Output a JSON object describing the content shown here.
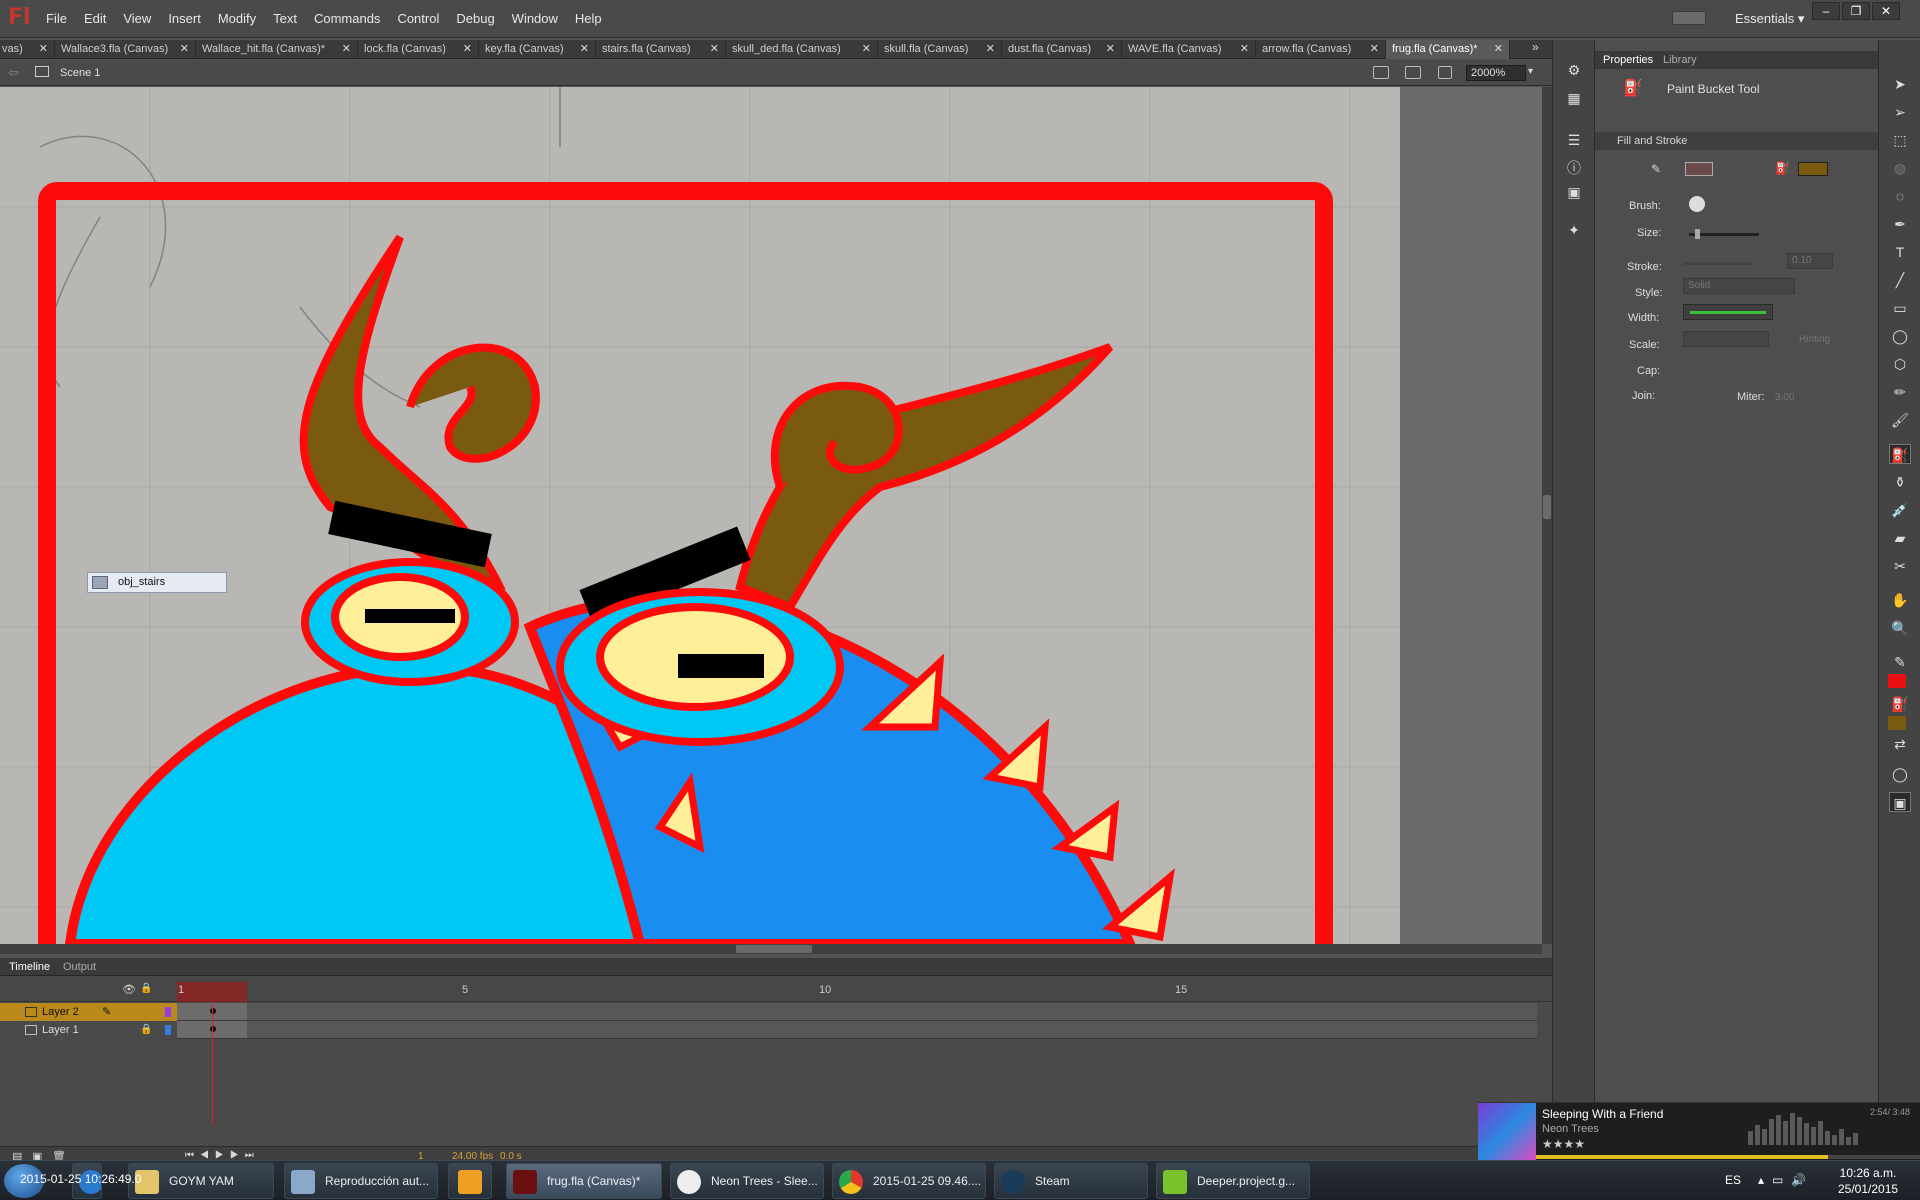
{
  "app": {
    "logo": "Fl"
  },
  "menu": {
    "items": [
      "File",
      "Edit",
      "View",
      "Insert",
      "Modify",
      "Text",
      "Commands",
      "Control",
      "Debug",
      "Window",
      "Help"
    ]
  },
  "workspace": {
    "label": "Essentials ▾"
  },
  "window_controls": {
    "minimize": "–",
    "restore": "❐",
    "close": "✕"
  },
  "tabs": [
    {
      "label": "vas)"
    },
    {
      "label": "Wallace3.fla (Canvas)"
    },
    {
      "label": "Wallace_hit.fla (Canvas)*"
    },
    {
      "label": "lock.fla (Canvas)"
    },
    {
      "label": "key.fla (Canvas)"
    },
    {
      "label": "stairs.fla (Canvas)"
    },
    {
      "label": "skull_ded.fla (Canvas)"
    },
    {
      "label": "skull.fla (Canvas)"
    },
    {
      "label": "dust.fla (Canvas)"
    },
    {
      "label": "WAVE.fla (Canvas)"
    },
    {
      "label": "arrow.fla (Canvas)"
    },
    {
      "label": "frug.fla (Canvas)*",
      "active": true
    }
  ],
  "tab_close": "✕",
  "tabs_more": "»",
  "scene": {
    "back": "⇦",
    "label": "Scene 1",
    "zoom": "2000%",
    "zoom_caret": "▾"
  },
  "tooltip": {
    "label": "obj_stairs"
  },
  "timeline": {
    "tabs": [
      "Timeline",
      "Output"
    ],
    "frame_numbers": [
      "1",
      "5",
      "10",
      "15"
    ],
    "layers": [
      {
        "name": "Layer 2",
        "active": true
      },
      {
        "name": "Layer 1",
        "active": false
      }
    ],
    "footer": {
      "current_frame": "1",
      "fps": "24.00 fps",
      "seconds": "0.0 s"
    }
  },
  "properties": {
    "tabs": [
      "Properties",
      "Library"
    ],
    "tool_name": "Paint Bucket Tool",
    "section": "Fill and Stroke",
    "labels": {
      "brush": "Brush:",
      "size": "Size:",
      "stroke": "Stroke:",
      "style": "Style:",
      "width": "Width:",
      "scale": "Scale:",
      "cap": "Cap:",
      "join": "Join:",
      "miter": "Miter:"
    },
    "values": {
      "stroke": "0.10",
      "style": "Solid",
      "hinting": "Hinting",
      "miter": "3.00"
    },
    "colors": {
      "stroke_swatch": "#6a4a4a",
      "fill_swatch": "#7a5a10"
    }
  },
  "tools": {
    "icons": [
      "selection-icon",
      "subselection-icon",
      "free-transform-icon",
      "3d-rotation-icon",
      "lasso-icon",
      "pen-icon",
      "text-icon",
      "line-icon",
      "rectangle-icon",
      "oval-icon",
      "polystar-icon",
      "pencil-icon",
      "brush-icon",
      "paint-bucket-icon",
      "ink-bottle-icon",
      "eyedropper-icon",
      "eraser-icon",
      "bone-icon",
      "hand-icon",
      "zoom-icon"
    ],
    "stroke_color": "#e81010",
    "fill_color": "#7a5a10"
  },
  "now_playing": {
    "title": "Sleeping With a Friend",
    "artist": "Neon Trees",
    "stars": "★★★★",
    "time": "2:54/ 3:48",
    "progress": 0.76
  },
  "taskbar": {
    "buttons": [
      {
        "label": "GOYM YAM"
      },
      {
        "label": "Reproducción aut..."
      },
      {
        "label": ""
      },
      {
        "label": "frug.fla (Canvas)*",
        "active": true
      },
      {
        "label": "Neon Trees - Slee..."
      },
      {
        "label": "2015-01-25 09.46...."
      },
      {
        "label": "Steam"
      },
      {
        "label": "Deeper.project.g..."
      }
    ],
    "overlay_time": "2015-01-25 10:26:49.0",
    "lang": "ES",
    "time": "10:26 a.m.",
    "date": "25/01/2015"
  }
}
